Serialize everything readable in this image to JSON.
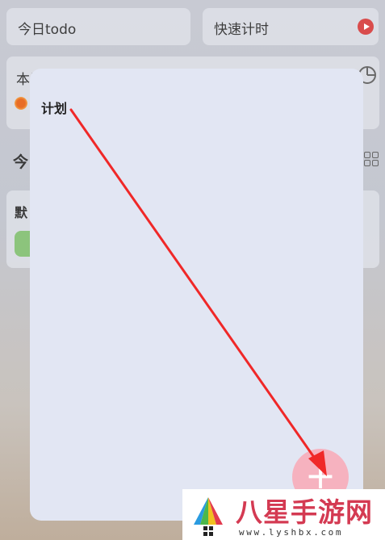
{
  "top_cards": {
    "todo_label": "今日todo",
    "timer_label": "快速计时"
  },
  "week": {
    "label": "本周"
  },
  "today": {
    "label": "今"
  },
  "list": {
    "label": "默"
  },
  "modal": {
    "title": "计划",
    "add_button_symbol": "+"
  },
  "watermark": {
    "title": "八星手游网",
    "url": "www.lyshbx.com"
  },
  "colors": {
    "modal_bg": "#e2e6f3",
    "accent_red": "#d94c4c",
    "fab_pink": "#f6b2bf",
    "arrow_red": "#f02828",
    "pill_green": "#8cc47c"
  }
}
